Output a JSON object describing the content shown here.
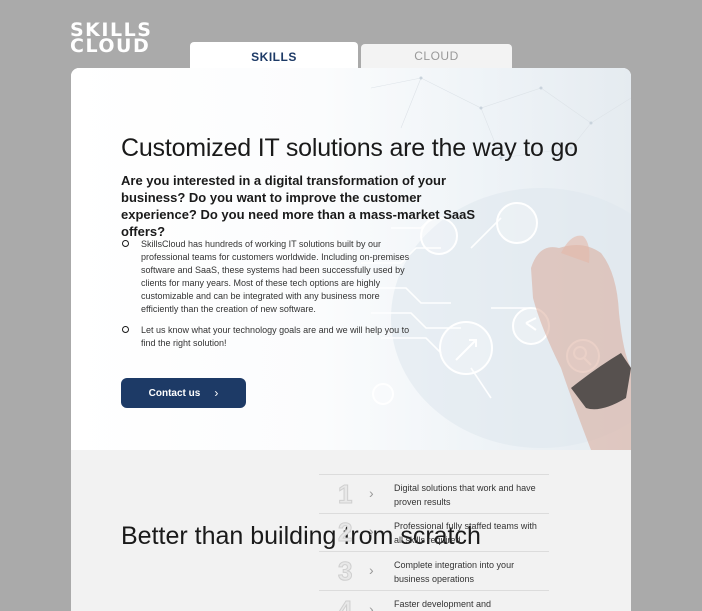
{
  "logo": {
    "line1": "SKILLS",
    "line2": "CLOUD"
  },
  "tabs": [
    {
      "label": "SKILLS",
      "active": true
    },
    {
      "label": "CLOUD",
      "active": false
    }
  ],
  "hero": {
    "title": "Customized IT solutions are the way to go",
    "subtitle": "Are you interested in a digital transformation of your business? Do you want to improve the customer experience? Do you need more than a mass-market SaaS offers?",
    "bullets": [
      "SkillsCloud has hundreds of working IT solutions built by our professional teams for customers worldwide. Including on-premises software and SaaS, these systems had been successfully used by clients for many years. Most of these tech options are highly customizable and can be integrated with any business more efficiently than the creation of new software.",
      "Let us know what your technology goals are and we will help you to find the right solution!"
    ],
    "contact_label": "Contact us",
    "contact_icon": "chevron-right-icon"
  },
  "lower": {
    "heading": "Better than building from scratch",
    "features": [
      {
        "num": "1",
        "text": "Digital solutions that work and have proven results"
      },
      {
        "num": "2",
        "text": "Professional fully staffed teams with all skills required"
      },
      {
        "num": "3",
        "text": "Complete integration into your business operations"
      },
      {
        "num": "4",
        "text": "Faster development and"
      }
    ]
  },
  "colors": {
    "background": "#aaaaaa",
    "accent": "#1d3a66",
    "card": "#ffffff",
    "lower_panel": "#f2f2f2"
  }
}
